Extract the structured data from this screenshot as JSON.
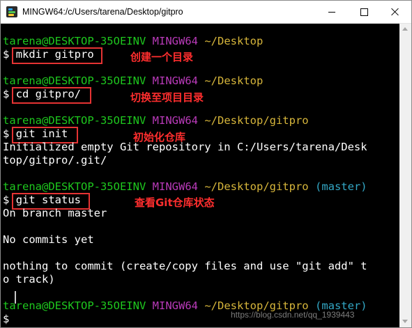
{
  "window": {
    "title": "MINGW64:/c/Users/tarena/Desktop/gitpro",
    "controls": [
      "minimize",
      "maximize",
      "close"
    ]
  },
  "terminal": {
    "colors": {
      "background": "#000000",
      "user_host": "#1ec81e",
      "mingw": "#b93ab9",
      "path": "#d7b63b",
      "branch": "#33a8c6",
      "annotation": "#ff2e2e"
    },
    "blocks": [
      {
        "prompt": {
          "user_host": "tarena@DESKTOP-35OEINV",
          "mingw": "MINGW64",
          "path": "~/Desktop",
          "branch": ""
        },
        "command": "mkdir gitpro",
        "annotation": "创建一个目录",
        "output": []
      },
      {
        "prompt": {
          "user_host": "tarena@DESKTOP-35OEINV",
          "mingw": "MINGW64",
          "path": "~/Desktop",
          "branch": ""
        },
        "command": "cd gitpro/",
        "annotation": "切换至项目目录",
        "output": []
      },
      {
        "prompt": {
          "user_host": "tarena@DESKTOP-35OEINV",
          "mingw": "MINGW64",
          "path": "~/Desktop/gitpro",
          "branch": ""
        },
        "command": "git init",
        "annotation": "初始化仓库",
        "output": [
          "Initialized empty Git repository in C:/Users/tarena/Desk",
          "top/gitpro/.git/"
        ]
      },
      {
        "prompt": {
          "user_host": "tarena@DESKTOP-35OEINV",
          "mingw": "MINGW64",
          "path": "~/Desktop/gitpro",
          "branch": "(master)"
        },
        "command": "git status",
        "annotation": "查看Git仓库状态",
        "output": [
          "On branch master",
          "",
          "No commits yet",
          "",
          "nothing to commit (create/copy files and use \"git add\" t",
          "o track)"
        ]
      },
      {
        "prompt": {
          "user_host": "tarena@DESKTOP-35OEINV",
          "mingw": "MINGW64",
          "path": "~/Desktop/gitpro",
          "branch": "(master)"
        },
        "command": "",
        "annotation": "",
        "output": []
      }
    ]
  },
  "prompt_symbol": "$",
  "watermark": "https://blog.csdn.net/qq_1939443"
}
